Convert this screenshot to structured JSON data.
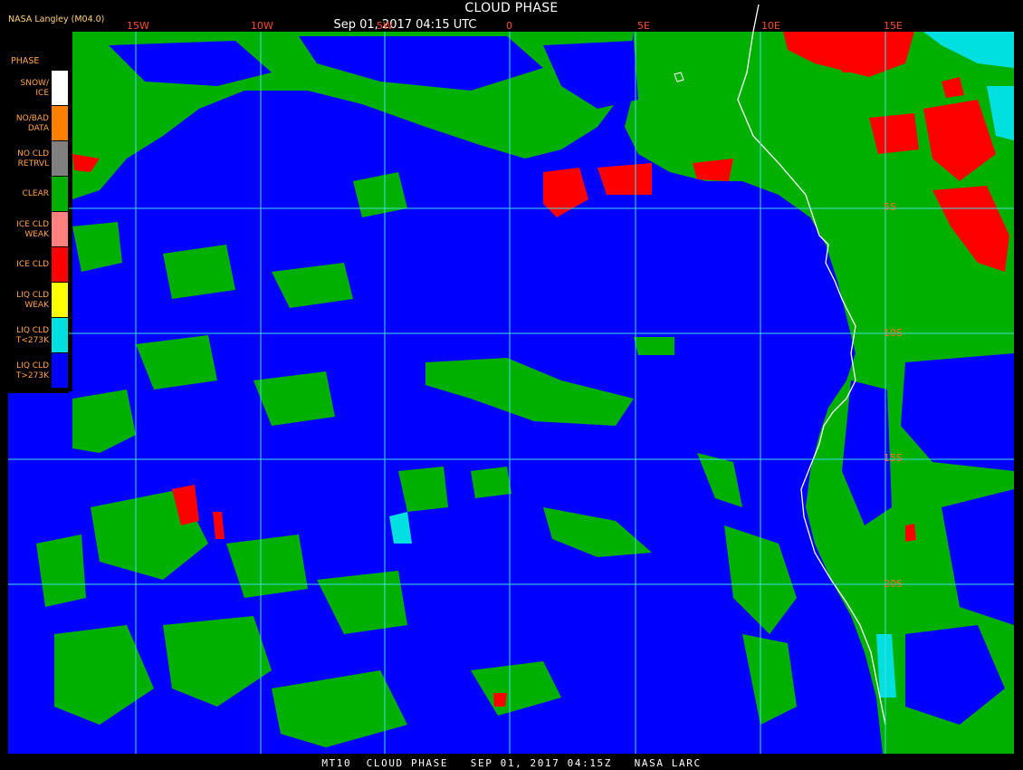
{
  "header": {
    "title": "CLOUD PHASE",
    "datetime": "Sep 01, 2017 04:15 UTC",
    "producer": "NASA Langley (M04.0)"
  },
  "legend": {
    "title": "PHASE",
    "items": [
      {
        "label": "SNOW/\nICE",
        "color": "#ffffff"
      },
      {
        "label": "NO/BAD\nDATA",
        "color": "#ff8000"
      },
      {
        "label": "NO CLD\nRETRVL",
        "color": "#808080"
      },
      {
        "label": "CLEAR",
        "color": "#00b000"
      },
      {
        "label": "ICE CLD\nWEAK",
        "color": "#ff8080"
      },
      {
        "label": "ICE CLD",
        "color": "#ff0000"
      },
      {
        "label": "LIQ CLD\nWEAK",
        "color": "#ffff00"
      },
      {
        "label": "LIQ CLD\nT<273K",
        "color": "#00e0e0"
      },
      {
        "label": "LIQ CLD\nT>273K",
        "color": "#0000ff"
      }
    ]
  },
  "grid": {
    "longitudes": [
      "15W",
      "10W",
      "5W",
      "0",
      "5E",
      "10E",
      "15E"
    ],
    "latitudes": [
      "5S",
      "10S",
      "15S",
      "20S"
    ]
  },
  "colors": {
    "ocean": "#0000ff",
    "clear": "#00b000",
    "ice": "#ff0000",
    "liquid_cold": "#00e0e0",
    "grid": "#40e0e0",
    "coast": "#ffffff"
  },
  "footer": {
    "caption": "MT10  CLOUD PHASE   SEP 01, 2017 04:15Z   NASA LARC"
  }
}
